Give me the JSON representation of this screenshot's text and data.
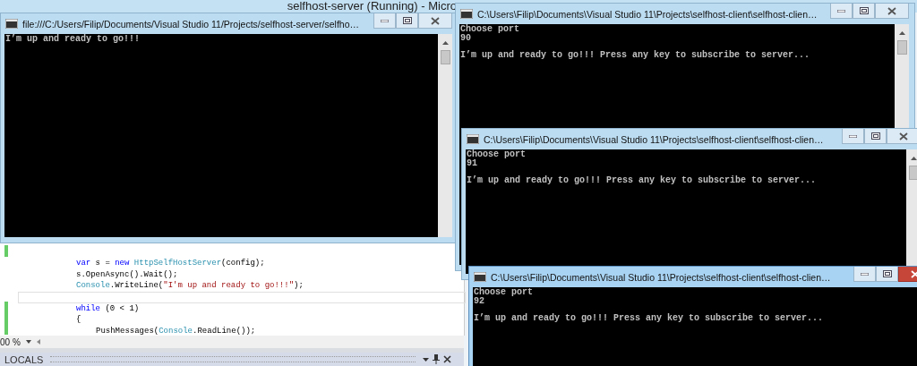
{
  "ide": {
    "title": "selfhost-server (Running) - Micro",
    "code": [
      {
        "kind": "code",
        "tokens": [
          {
            "text": "var",
            "kind": "keyword"
          },
          {
            "text": " s = ",
            "kind": "plain"
          },
          {
            "text": "new ",
            "kind": "keyword"
          },
          {
            "text": "HttpSelfHostServer",
            "kind": "type"
          },
          {
            "text": "(config);",
            "kind": "plain"
          }
        ]
      },
      {
        "kind": "code",
        "tokens": [
          {
            "text": "s.OpenAsync().Wait();",
            "kind": "plain"
          }
        ]
      },
      {
        "kind": "code",
        "tokens": [
          {
            "text": "Console",
            "kind": "type"
          },
          {
            "text": ".WriteLine(",
            "kind": "plain"
          },
          {
            "text": "\"I'm up and ready to go!!!\"",
            "kind": "string"
          },
          {
            "text": ");",
            "kind": "plain"
          }
        ]
      },
      {
        "kind": "current"
      },
      {
        "kind": "code",
        "tokens": [
          {
            "text": "while",
            "kind": "keyword"
          },
          {
            "text": " (0 < 1)",
            "kind": "plain"
          }
        ]
      },
      {
        "kind": "code",
        "tokens": [
          {
            "text": "{",
            "kind": "plain"
          }
        ]
      },
      {
        "kind": "nested",
        "tokens": [
          {
            "text": "PushMessages(",
            "kind": "plain"
          },
          {
            "text": "Console",
            "kind": "type"
          },
          {
            "text": ".ReadLine());",
            "kind": "plain"
          }
        ]
      }
    ],
    "zoom": "00 %",
    "panel": {
      "title": "LOCALS"
    }
  },
  "windows": [
    {
      "title": "file:///C:/Users/Filip/Documents/Visual Studio 11/Projects/selfhost-server/selfho…",
      "active": false,
      "output": [
        [
          "I’m up and ready to go!!!"
        ]
      ]
    },
    {
      "title": "C:\\Users\\Filip\\Documents\\Visual Studio 11\\Projects\\selfhost-client\\selfhost-clien…",
      "active": false,
      "output": [
        [
          "Choose port",
          "90"
        ],
        [
          "I’m up and ready to go!!! Press any key to subscribe to server..."
        ]
      ]
    },
    {
      "title": "C:\\Users\\Filip\\Documents\\Visual Studio 11\\Projects\\selfhost-client\\selfhost-clien…",
      "active": false,
      "output": [
        [
          "Choose port",
          "91"
        ],
        [
          "I’m up and ready to go!!! Press any key to subscribe to server..."
        ]
      ]
    },
    {
      "title": "C:\\Users\\Filip\\Documents\\Visual Studio 11\\Projects\\selfhost-client\\selfhost-clien…",
      "active": true,
      "output": [
        [
          "Choose port",
          "92"
        ],
        [
          "I’m up and ready to go!!! Press any key to subscribe to server..."
        ]
      ]
    }
  ]
}
